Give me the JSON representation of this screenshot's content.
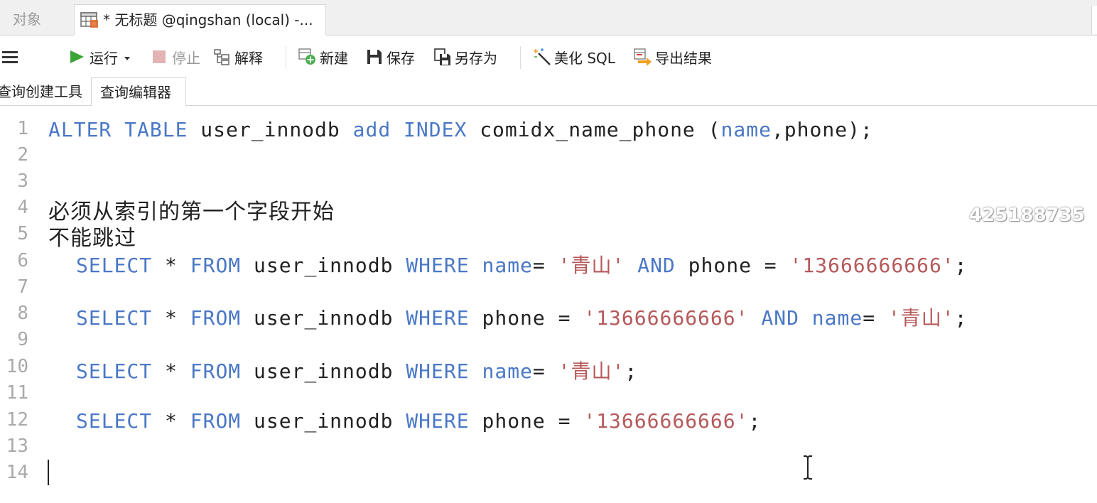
{
  "tabs": {
    "objects_label": "对象",
    "query_label": "* 无标题 @qingshan (local) -..."
  },
  "toolbar": {
    "run_label": "运行",
    "stop_label": "停止",
    "explain_label": "解释",
    "new_label": "新建",
    "save_label": "保存",
    "save_as_label": "另存为",
    "beautify_label": "美化 SQL",
    "export_label": "导出结果"
  },
  "subtabs": {
    "builder_label": "查询创建工具",
    "editor_label": "查询编辑器"
  },
  "editor": {
    "line_numbers": [
      "1",
      "2",
      "3",
      "4",
      "5",
      "6",
      "7",
      "8",
      "9",
      "10",
      "11",
      "12",
      "13",
      "14"
    ],
    "line1": {
      "kw1": "ALTER",
      "kw2": "TABLE",
      "t1": " user_innodb ",
      "kw3": "add",
      "kw4": "INDEX",
      "t2": " comidx_name_phone (",
      "kw5": "name",
      "t3": ",phone);"
    },
    "comment1": "必须从索引的第一个字段开始",
    "comment2": "不能跳过",
    "q1": {
      "select": "SELECT",
      "star": " * ",
      "from": "FROM",
      "table": " user_innodb ",
      "where": "WHERE",
      "col1": "name",
      "op1": "= ",
      "val1": "'青山'",
      "and": "AND",
      "col2": " phone = ",
      "val2": "'13666666666'",
      "end": ";"
    },
    "q2": {
      "select": "SELECT",
      "star": " * ",
      "from": "FROM",
      "table": " user_innodb ",
      "where": "WHERE",
      "col1": " phone = ",
      "val1": "'13666666666'",
      "and": "AND",
      "col2": "name",
      "op2": "= ",
      "val2": "'青山'",
      "end": ";"
    },
    "q3": {
      "select": "SELECT",
      "star": " * ",
      "from": "FROM",
      "table": " user_innodb ",
      "where": "WHERE",
      "col1": "name",
      "op1": "= ",
      "val1": "'青山'",
      "end": ";"
    },
    "q4": {
      "select": "SELECT",
      "star": " * ",
      "from": "FROM",
      "table": " user_innodb ",
      "where": "WHERE",
      "col1": " phone = ",
      "val1": "'13666666666'",
      "end": ";"
    }
  },
  "watermark": "425188735"
}
